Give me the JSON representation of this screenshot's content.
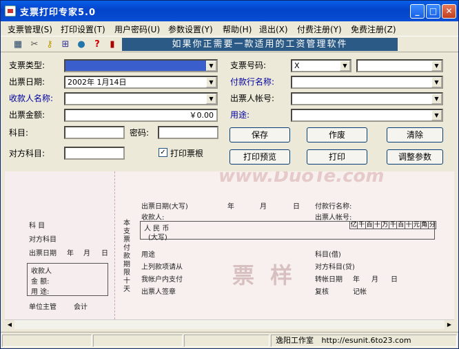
{
  "window": {
    "title": "支票打印专家5.0"
  },
  "menu": [
    "支票管理(S)",
    "打印设置(T)",
    "用户密码(U)",
    "参数设置(Y)",
    "帮助(H)",
    "退出(X)",
    "付费注册(Y)",
    "免费注册(Z)"
  ],
  "toolbar": {
    "banner": "如果你正需要一款适用的工资管理软件"
  },
  "form": {
    "cheque_type_label": "支票类型:",
    "cheque_no_label": "支票号码:",
    "cheque_no_prefix": "X",
    "issue_date_label": "出票日期:",
    "issue_date_value": "2002年 1月14日",
    "payer_bank_label": "付款行名称:",
    "payee_label": "收款人名称:",
    "drawer_account_label": "出票人帐号:",
    "amount_label": "出票金额:",
    "amount_value": "￥0.00",
    "purpose_label": "用途:",
    "subject_label": "科目:",
    "password_label": "密码:",
    "counter_subject_label": "对方科目:",
    "print_stub_label": "打印票根",
    "print_stub_checked": "✓"
  },
  "buttons": {
    "save": "保存",
    "void": "作废",
    "clear": "清除",
    "preview": "打印预览",
    "print": "打印",
    "adjust": "调整参数"
  },
  "cheque": {
    "stub": {
      "subject": "科    目",
      "counter": "对方科目",
      "date": "出票日期",
      "year": "年",
      "month": "月",
      "day": "日",
      "payee": "收款人",
      "amount": "金    额:",
      "purpose": "用    途:",
      "supervisor": "单位主管",
      "accountant": "会计"
    },
    "vertical_note": "本支票付款期限十天",
    "date_cap": "出票日期(大写)",
    "year": "年",
    "month": "月",
    "day": "日",
    "payer_bank": "付款行名称:",
    "payee": "收款人:",
    "drawer_acct": "出票人帐号:",
    "rmb": "人 民 币",
    "rmb_cap": "(大写)",
    "digits": [
      "亿",
      "千",
      "百",
      "十",
      "万",
      "千",
      "百",
      "十",
      "元",
      "角",
      "分"
    ],
    "purpose": "用途",
    "listed": "上列款项请从",
    "from_acct": "我帐户内支付",
    "drawer_sign": "出票人签章",
    "debit": "科目(借)",
    "credit": "对方科目(贷)",
    "transfer_date": "转帐日期",
    "t_year": "年",
    "t_month": "月",
    "t_day": "日",
    "review": "复核",
    "record": "记帐",
    "watermark": "票 样",
    "wm1": "www.DuoTe.com"
  },
  "status": {
    "company": "逸阳工作室",
    "url": "http://esunit.6to23.com"
  }
}
